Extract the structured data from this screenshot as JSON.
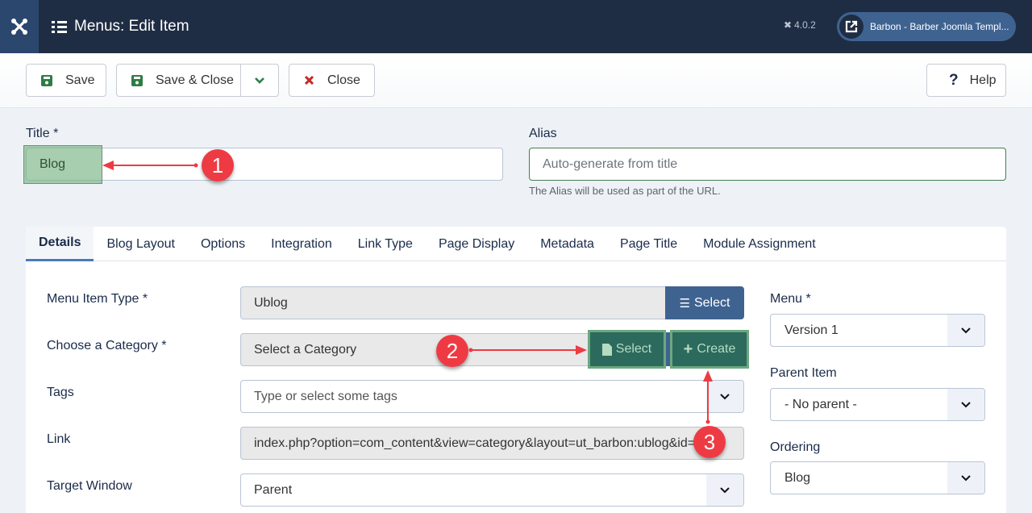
{
  "header": {
    "title": "Menus: Edit Item",
    "version": "4.0.2",
    "site_link": "Barbon - Barber Joomla Templ...",
    "icons": {
      "logo": "joomla-logo-icon",
      "title": "list-icon",
      "version": "joomla-small-icon",
      "site": "external-link-icon"
    }
  },
  "toolbar": {
    "save": "Save",
    "save_close": "Save & Close",
    "close": "Close",
    "help": "Help",
    "colors": {
      "save_icon": "#2f7d45",
      "close_icon": "#c52827"
    }
  },
  "form": {
    "title_label": "Title *",
    "title_value": "Blog",
    "alias_label": "Alias",
    "alias_placeholder": "Auto-generate from title",
    "alias_help": "The Alias will be used as part of the URL."
  },
  "tabs": [
    {
      "label": "Details",
      "active": true
    },
    {
      "label": "Blog Layout",
      "active": false
    },
    {
      "label": "Options",
      "active": false
    },
    {
      "label": "Integration",
      "active": false
    },
    {
      "label": "Link Type",
      "active": false
    },
    {
      "label": "Page Display",
      "active": false
    },
    {
      "label": "Metadata",
      "active": false
    },
    {
      "label": "Page Title",
      "active": false
    },
    {
      "label": "Module Assignment",
      "active": false
    }
  ],
  "details": {
    "menu_item_type": {
      "label": "Menu Item Type *",
      "value": "Ublog",
      "button": "Select"
    },
    "category": {
      "label": "Choose a Category *",
      "value": "Select a Category",
      "select_button": "Select",
      "create_button": "Create"
    },
    "tags": {
      "label": "Tags",
      "placeholder": "Type or select some tags"
    },
    "link": {
      "label": "Link",
      "value": "index.php?option=com_content&view=category&layout=ut_barbon:ublog&id="
    },
    "target_window": {
      "label": "Target Window",
      "value": "Parent"
    }
  },
  "sidebar": {
    "menu": {
      "label": "Menu *",
      "value": "Version 1"
    },
    "parent_item": {
      "label": "Parent Item",
      "value": "- No parent -"
    },
    "ordering": {
      "label": "Ordering",
      "value": "Blog"
    }
  },
  "annotations": [
    "1",
    "2",
    "3"
  ]
}
